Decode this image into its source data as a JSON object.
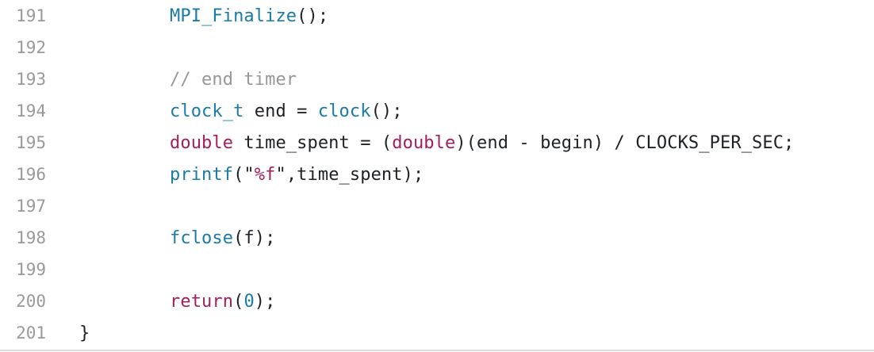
{
  "lines": [
    {
      "number": "191",
      "code": [
        [
          "fn",
          "MPI_Finalize"
        ],
        [
          "plain",
          "();"
        ]
      ]
    },
    {
      "number": "192",
      "code": []
    },
    {
      "number": "193",
      "code": [
        [
          "cm",
          "// end timer"
        ]
      ]
    },
    {
      "number": "194",
      "code": [
        [
          "type",
          "clock_t"
        ],
        [
          "plain",
          " end = "
        ],
        [
          "fn",
          "clock"
        ],
        [
          "plain",
          "();"
        ]
      ]
    },
    {
      "number": "195",
      "code": [
        [
          "kw",
          "double"
        ],
        [
          "plain",
          " time_spent = ("
        ],
        [
          "kw",
          "double"
        ],
        [
          "plain",
          ")(end - begin) / CLOCKS_PER_SEC;"
        ]
      ]
    },
    {
      "number": "196",
      "code": [
        [
          "fn",
          "printf"
        ],
        [
          "plain",
          "(\""
        ],
        [
          "fmt",
          "%f"
        ],
        [
          "plain",
          "\",time_spent);"
        ]
      ]
    },
    {
      "number": "197",
      "code": []
    },
    {
      "number": "198",
      "code": [
        [
          "fn",
          "fclose"
        ],
        [
          "plain",
          "(f);"
        ]
      ]
    },
    {
      "number": "199",
      "code": []
    },
    {
      "number": "200",
      "code": [
        [
          "kw",
          "return"
        ],
        [
          "plain",
          "("
        ],
        [
          "num",
          "0"
        ],
        [
          "plain",
          ");"
        ]
      ]
    },
    {
      "number": "201",
      "code": [
        [
          "plain",
          "}"
        ]
      ]
    }
  ],
  "colors": {
    "function": "#1a7ba8",
    "keyword": "#a61d5c",
    "comment": "#969896",
    "text": "#1d2125",
    "line_number": "#999999"
  }
}
